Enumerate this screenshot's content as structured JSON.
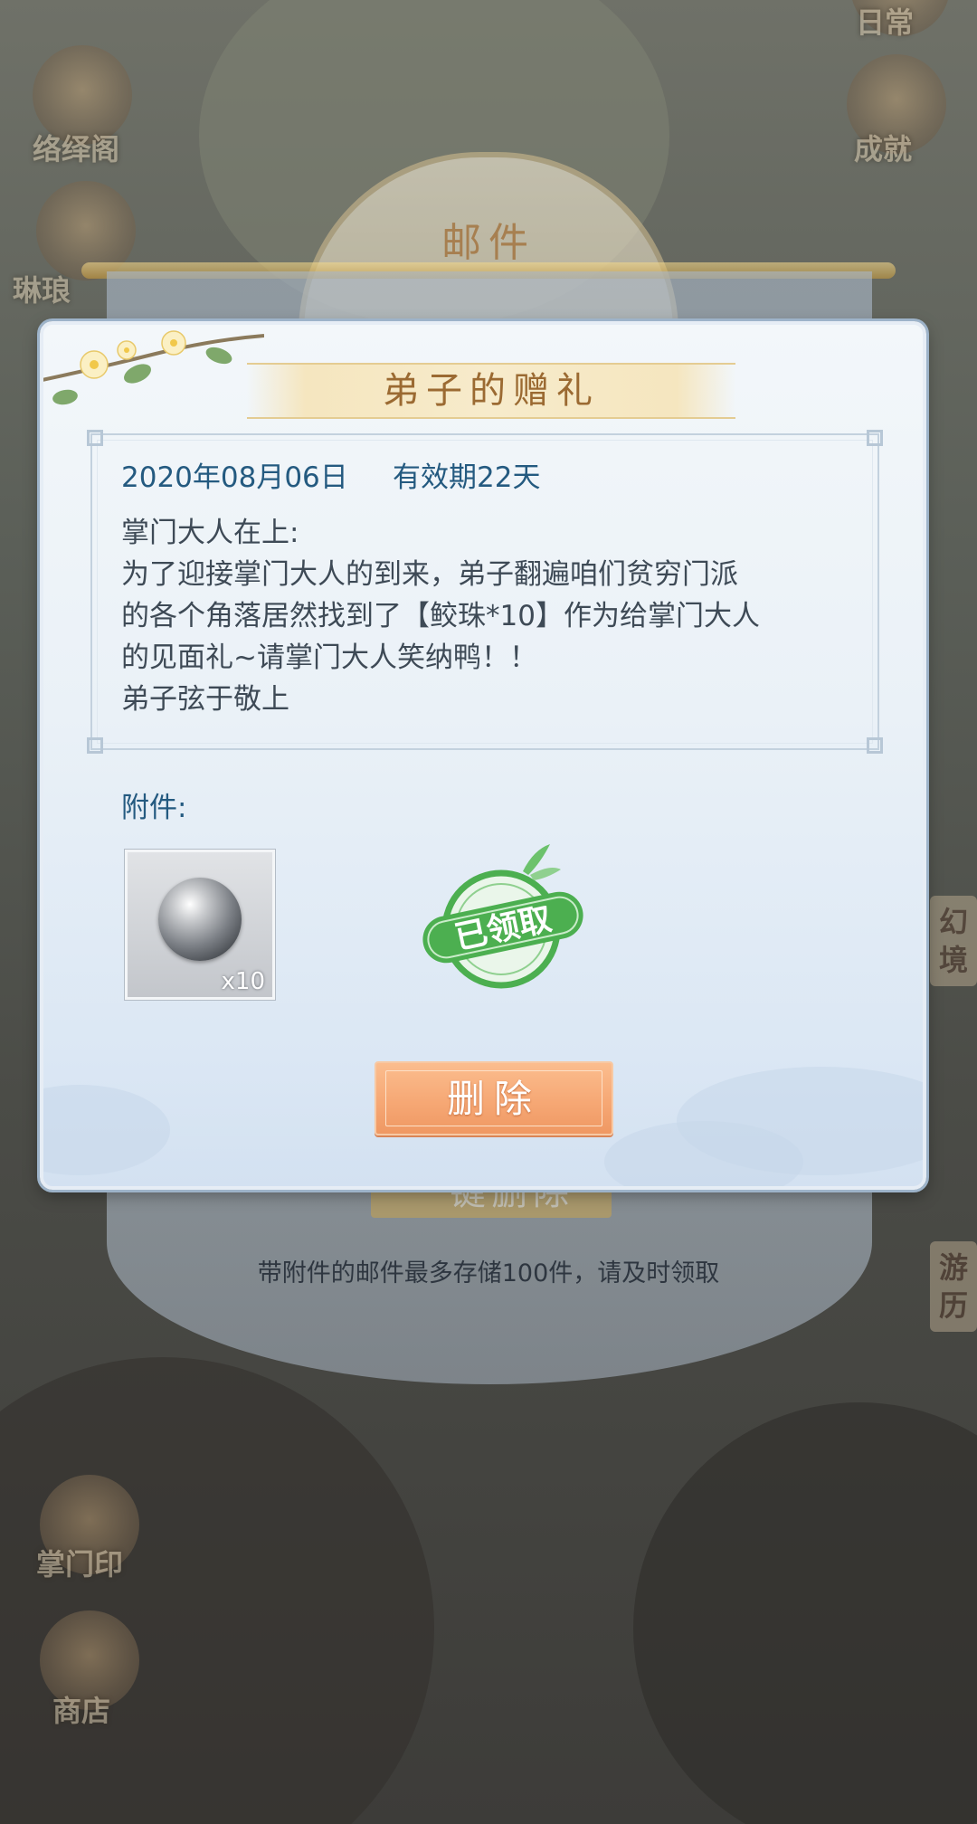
{
  "background": {
    "title": "邮件",
    "side_labels": [
      "日常",
      "络绎阁",
      "成就",
      "琳琅",
      "掌门印",
      "商店"
    ],
    "side_tags": [
      "幻境",
      "游历"
    ],
    "hidden_bulk_button": "一键删除",
    "storage_note": "带附件的邮件最多存储100件，请及时领取"
  },
  "dialog": {
    "title": "弟子的赠礼",
    "date": "2020年08月06日",
    "validity": "有效期22天",
    "body_lines": [
      "掌门大人在上:",
      "为了迎接掌门大人的到来，弟子翻遍咱们贫穷门派",
      "的各个角落居然找到了【鲛珠*10】作为给掌门大人",
      "的见面礼~请掌门大人笑纳鸭！！",
      "弟子弦于敬上"
    ],
    "attachment_label": "附件:",
    "attachment": {
      "icon": "pearl-icon",
      "quantity": "x10"
    },
    "claimed_stamp": "已领取",
    "delete_button": "删除"
  },
  "colors": {
    "accent_blue": "#245a80",
    "title_gold": "#9b6a32",
    "button_orange": "#f6a875",
    "stamp_green": "#4caf50"
  }
}
